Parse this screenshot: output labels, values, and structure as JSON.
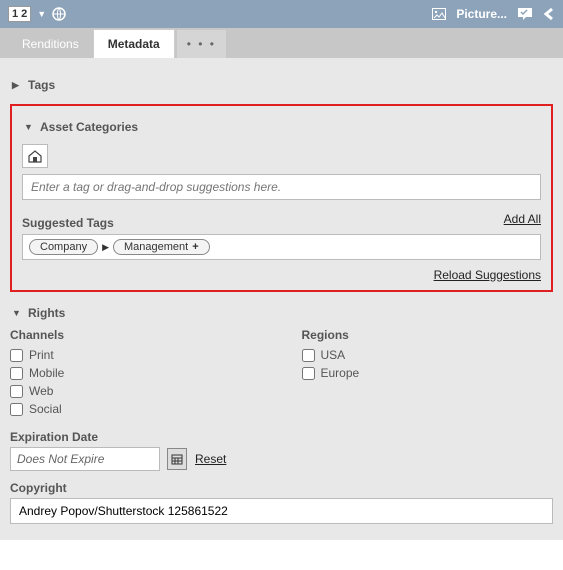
{
  "topbar": {
    "view_toggle": "1 2",
    "picture_label": "Picture..."
  },
  "tabs": {
    "renditions": "Renditions",
    "metadata": "Metadata",
    "overflow": "• • •"
  },
  "sections": {
    "tags": {
      "title": "Tags"
    },
    "asset_categories": {
      "title": "Asset Categories",
      "tag_placeholder": "Enter a tag or drag-and-drop suggestions here.",
      "suggested_label": "Suggested Tags",
      "add_all": "Add All",
      "reload": "Reload Suggestions",
      "suggestions": {
        "company": "Company",
        "management": "Management"
      }
    },
    "rights": {
      "title": "Rights",
      "channels_label": "Channels",
      "regions_label": "Regions",
      "channels": {
        "print": "Print",
        "mobile": "Mobile",
        "web": "Web",
        "social": "Social"
      },
      "regions": {
        "usa": "USA",
        "europe": "Europe"
      },
      "expiration_label": "Expiration Date",
      "expiration_value": "Does Not Expire",
      "reset": "Reset",
      "copyright_label": "Copyright",
      "copyright_value": "Andrey Popov/Shutterstock 125861522"
    }
  }
}
